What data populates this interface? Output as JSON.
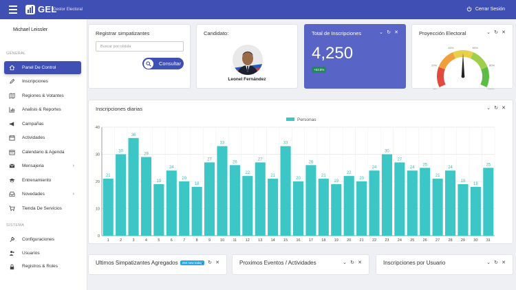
{
  "app": {
    "brand": "GEL",
    "brand_sub": "Gestor Electoral",
    "logout_label": "Cerrar Sesión"
  },
  "sidebar": {
    "user_name": "Michael Leissler",
    "section_general": "GENERAL",
    "section_sistema": "SISTEMA",
    "items": [
      {
        "label": "Panel De Control",
        "icon": "home-icon"
      },
      {
        "label": "Inscripciones",
        "icon": "pencil-icon"
      },
      {
        "label": "Regiones & Votantes",
        "icon": "map-icon"
      },
      {
        "label": "Analisis & Reportes",
        "icon": "chart-icon"
      },
      {
        "label": "Campañas",
        "icon": "megaphone-icon"
      },
      {
        "label": "Actividades",
        "icon": "calendar-icon"
      },
      {
        "label": "Calendario & Agenda",
        "icon": "calendar-agenda-icon"
      },
      {
        "label": "Mensajeria",
        "icon": "envelope-icon"
      },
      {
        "label": "Entrenamiento",
        "icon": "graduation-cap-icon"
      },
      {
        "label": "Novedades",
        "icon": "inbox-icon"
      },
      {
        "label": "Tienda De Servicios",
        "icon": "cart-icon"
      }
    ],
    "system_items": [
      {
        "label": "Configuraciones",
        "icon": "wrench-icon"
      },
      {
        "label": "Usuarios",
        "icon": "users-icon"
      },
      {
        "label": "Registros & Roles",
        "icon": "lock-icon"
      }
    ]
  },
  "register": {
    "title": "Registrar simpatizantes",
    "search_placeholder": "Buscar por cédula",
    "button_label": "Consultar"
  },
  "candidate": {
    "title": "Candidato:",
    "name": "Leonel Fernández"
  },
  "kpi": {
    "title": "Total de Inscripciones",
    "value": "4,250",
    "badge": "+53.8%"
  },
  "gauge": {
    "title": "Proyección Electoral",
    "value_percent": 50,
    "labels": [
      "0%",
      "20%",
      "40%",
      "60%",
      "80%",
      "100%"
    ],
    "colors": [
      "#e04a3f",
      "#f0a03a",
      "#e9cf4a",
      "#9fcf4a",
      "#5dbb46"
    ]
  },
  "daily": {
    "title": "Inscripciones diarias"
  },
  "chart_data": {
    "type": "bar",
    "series": [
      {
        "name": "Personas",
        "values": [
          21,
          30,
          36,
          29,
          19,
          24,
          20,
          18,
          27,
          33,
          26,
          22,
          27,
          21,
          33,
          20,
          26,
          21,
          19,
          22,
          20,
          24,
          30,
          27,
          24,
          25,
          21,
          24,
          19,
          18,
          25
        ]
      }
    ],
    "categories": [
      "1",
      "2",
      "3",
      "4",
      "5",
      "6",
      "7",
      "8",
      "9",
      "10",
      "11",
      "12",
      "13",
      "14",
      "15",
      "16",
      "17",
      "18",
      "19",
      "20",
      "21",
      "22",
      "23",
      "24",
      "25",
      "26",
      "27",
      "28",
      "29",
      "30",
      "31"
    ],
    "ylim": [
      0,
      40
    ],
    "yticks": [
      "0",
      "10",
      "20",
      "30",
      "40"
    ],
    "color": "#3cc6c6",
    "legend_position": "top-center",
    "grid": true
  },
  "bottom": {
    "latest_title": "Ultimos Simpatizantes Agregados",
    "latest_badge": "250 new today",
    "events_title": "Proximos Eventos / Actividades",
    "per_user_title": "Inscripciones por Usuario"
  },
  "tool_icons": [
    "chevron-down-icon",
    "refresh-icon",
    "close-icon"
  ]
}
